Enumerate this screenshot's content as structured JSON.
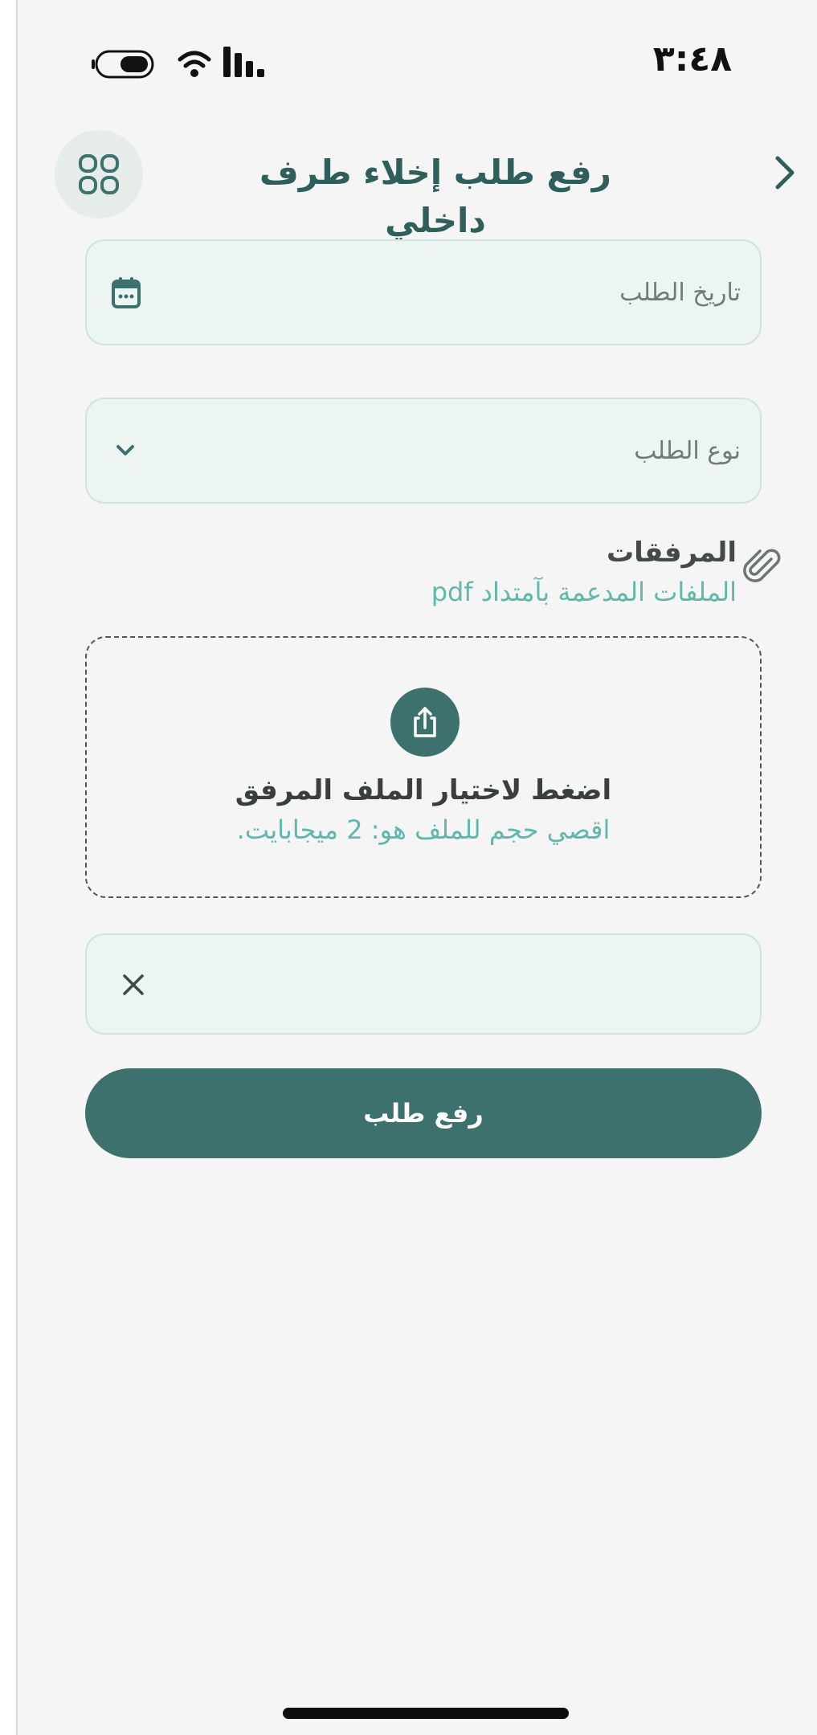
{
  "status_bar": {
    "time": "٣:٤٨"
  },
  "header": {
    "title": "رفع طلب إخلاء طرف داخلي",
    "back_icon": "chevron-right-icon",
    "menu_icon": "grid-icon"
  },
  "form": {
    "date_field": {
      "placeholder": "تاريخ الطلب",
      "icon": "calendar-icon"
    },
    "type_field": {
      "placeholder": "نوع الطلب",
      "icon": "chevron-down-icon"
    }
  },
  "attachments": {
    "title": "المرفقات",
    "subtitle": "الملفات المدعمة بآمتداد pdf",
    "icon": "paperclip-icon",
    "dropzone": {
      "title": "اضغط لاختيار الملف المرفق",
      "subtitle": "اقصي حجم للملف هو: 2 ميجابايت.",
      "icon": "upload-icon"
    }
  },
  "selected_file": {
    "remove_icon": "close-icon"
  },
  "submit": {
    "label": "رفع طلب"
  },
  "colors": {
    "primary": "#3d716d",
    "accent_text": "#5fb8ac",
    "field_bg": "#edf5f3",
    "field_border": "#cfe3e2",
    "background": "#f4f5f4"
  }
}
